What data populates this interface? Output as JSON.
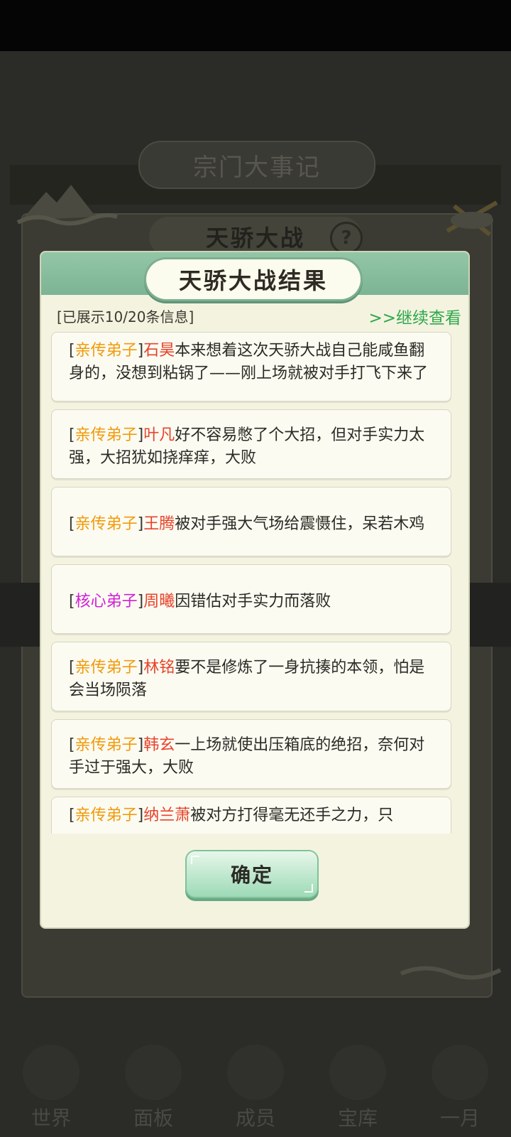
{
  "background": {
    "banner_title": "宗门大事记",
    "subtitle": "天骄大战",
    "help_icon": "?",
    "nav": [
      "世界",
      "面板",
      "成员",
      "宝库",
      "一月"
    ]
  },
  "modal": {
    "title": "天骄大战结果",
    "info_count": "[已展示10/20条信息]",
    "continue_link": ">>继续查看",
    "confirm_label": "确定",
    "entries": [
      {
        "open": "[",
        "rank": "亲传弟子",
        "close": "]",
        "name": "石昊",
        "text": "本来想着这次天骄大战自己能咸鱼翻身的，没想到粘锅了——刚上场就被对手打飞下来了"
      },
      {
        "open": "[",
        "rank": "亲传弟子",
        "close": "]",
        "name": "叶凡",
        "text": "好不容易憋了个大招，但对手实力太强，大招犹如挠痒痒，大败"
      },
      {
        "open": "[",
        "rank": "亲传弟子",
        "close": "]",
        "name": "王腾",
        "text": "被对手强大气场给震慑住，呆若木鸡"
      },
      {
        "open": "[",
        "rank": "核心弟子",
        "close": "]",
        "name": "周曦",
        "text": "因错估对手实力而落败"
      },
      {
        "open": "[",
        "rank": "亲传弟子",
        "close": "]",
        "name": "林铭",
        "text": "要不是修炼了一身抗揍的本领，怕是会当场陨落"
      },
      {
        "open": "[",
        "rank": "亲传弟子",
        "close": "]",
        "name": "韩玄",
        "text": "一上场就使出压箱底的绝招，奈何对手过于强大，大败"
      },
      {
        "open": "[",
        "rank": "亲传弟子",
        "close": "]",
        "name": "纳兰萧",
        "text": "被对方打得毫无还手之力，只"
      }
    ]
  },
  "colors": {
    "rank_inner": "#f29a0a",
    "rank_core": "#d21fd6",
    "name": "#e8432a",
    "link": "#2ea84c",
    "header": "#7cb494"
  }
}
